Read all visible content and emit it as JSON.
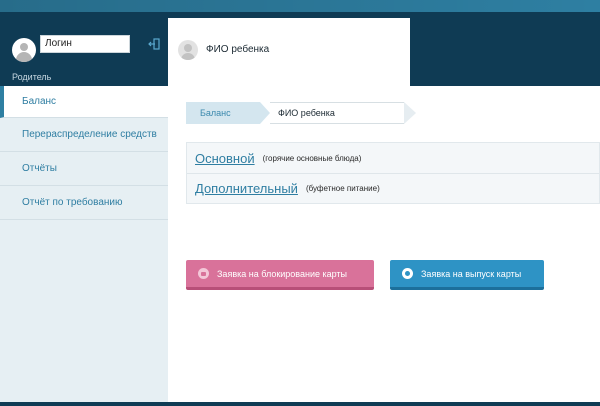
{
  "header": {
    "login_value": "Логин",
    "role": "Родитель",
    "logout_icon": "logout-icon"
  },
  "sidebar": {
    "items": [
      {
        "label": "Баланс",
        "active": true
      },
      {
        "label": "Перераспределение средств",
        "active": false
      },
      {
        "label": "Отчёты",
        "active": false
      },
      {
        "label": "Отчёт по требованию",
        "active": false
      }
    ]
  },
  "child": {
    "name": "ФИО ребенка"
  },
  "breadcrumb": {
    "items": [
      "Баланс",
      "ФИО ребенка"
    ]
  },
  "accounts": [
    {
      "title": "Основной",
      "note": "(горячие основные блюда)"
    },
    {
      "title": "Дополнительный",
      "note": "(буфетное питание)"
    }
  ],
  "actions": {
    "block_card": "Заявка на блокирование карты",
    "issue_card": "Заявка на выпуск карты"
  },
  "colors": {
    "header_bg": "#0f3b54",
    "accent": "#2e7fa2",
    "block_button": "#d9729a",
    "issue_button": "#2e93c5"
  }
}
